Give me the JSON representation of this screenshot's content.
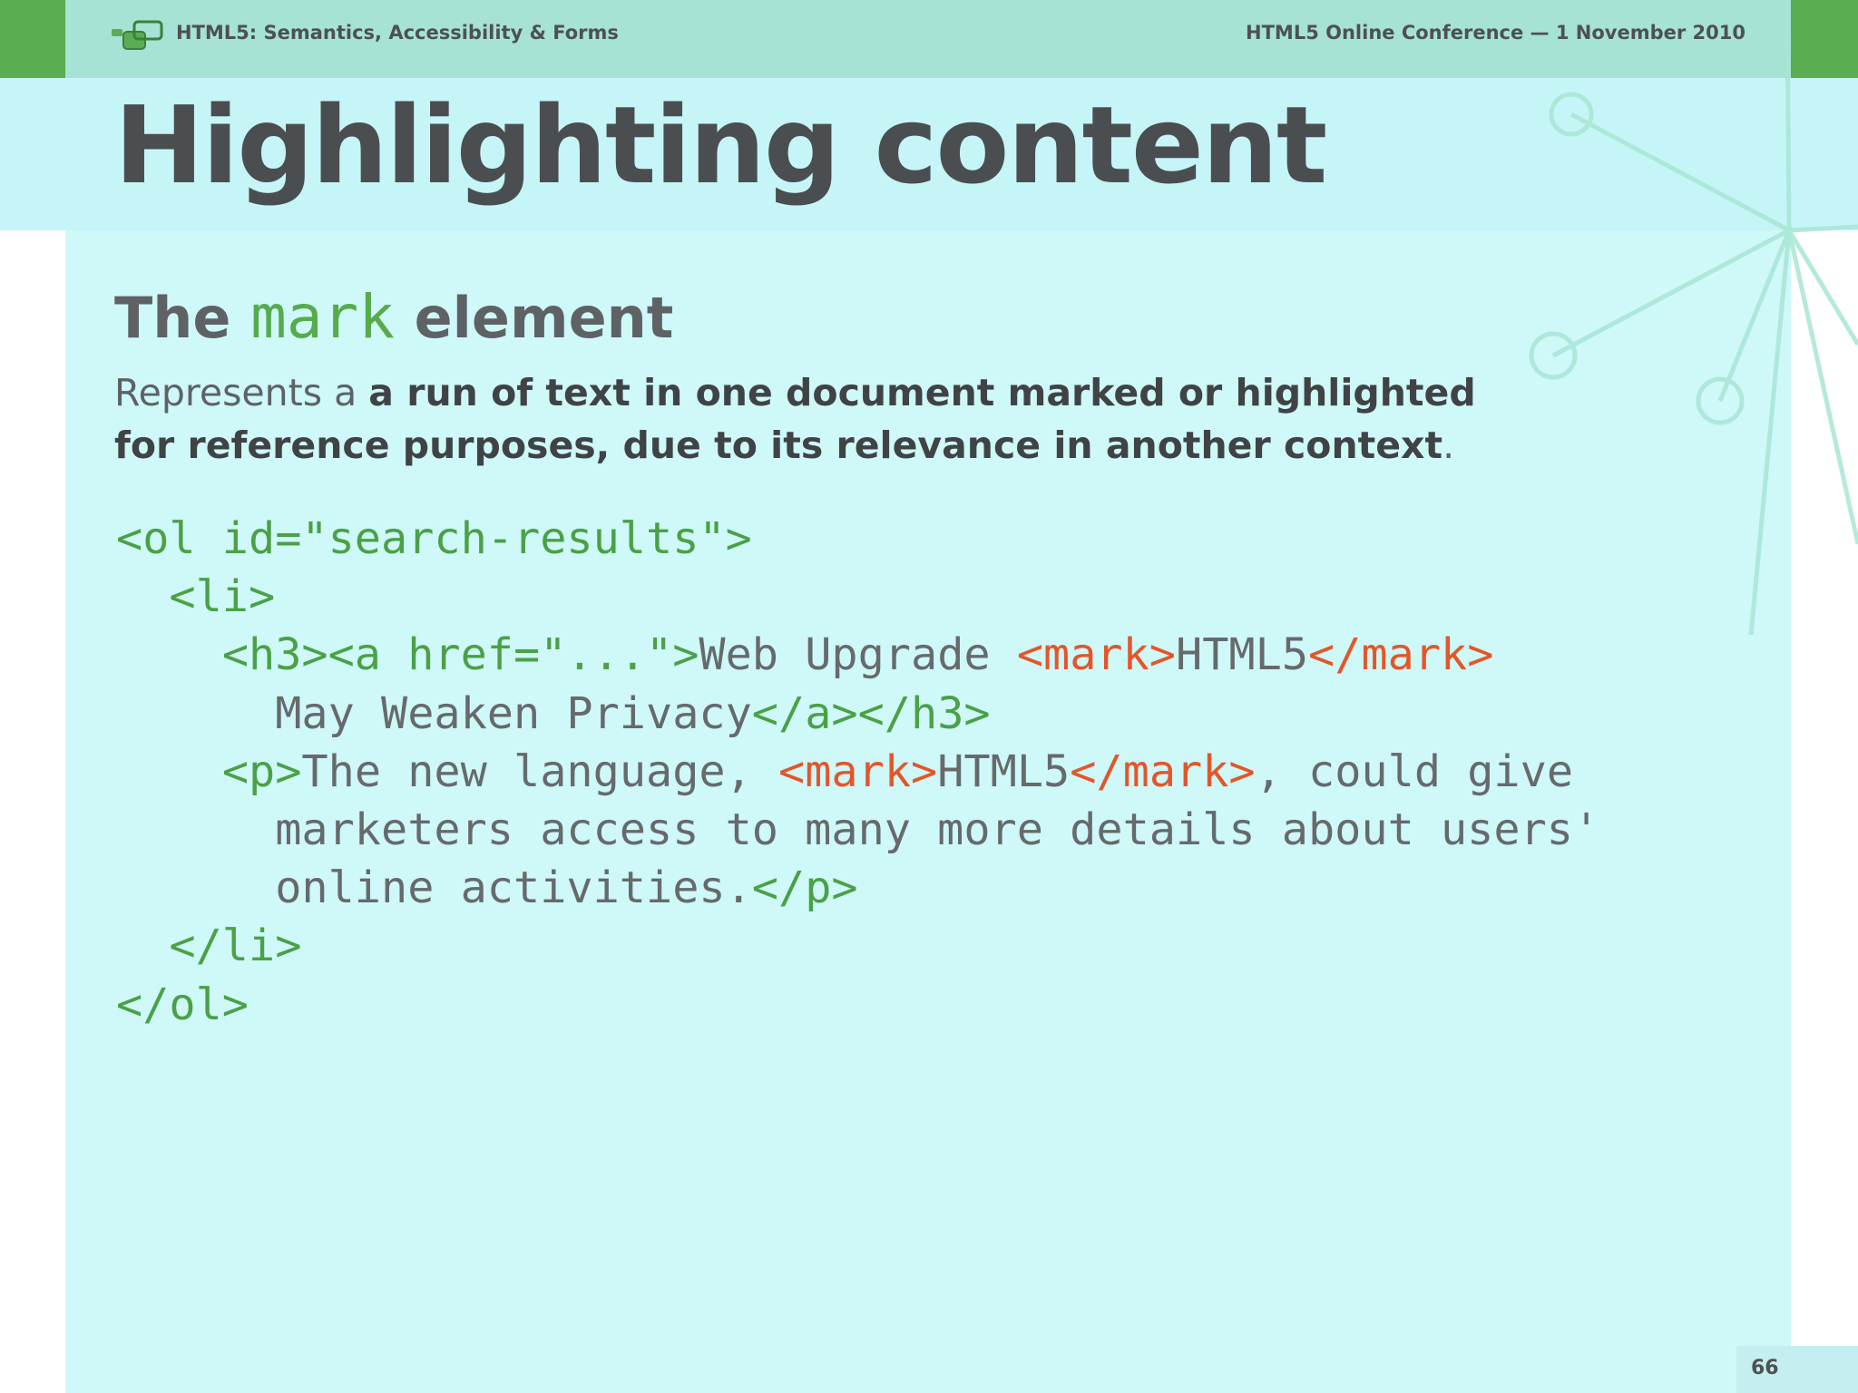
{
  "header": {
    "left_text": "HTML5: Semantics, Accessibility & Forms",
    "right_text": "HTML5 Online Conference — 1 November 2010"
  },
  "slide": {
    "title": "Highlighting content",
    "subtitle_pre": "The ",
    "subtitle_keyword": "mark",
    "subtitle_post": " element",
    "desc_plain": "Represents a ",
    "desc_bold": "a run of text in one document marked or highlighted for reference purposes, due to its relevance in another context",
    "desc_end": "."
  },
  "code": {
    "lines": [
      [
        [
          "t",
          "<ol id=\"search-results\">"
        ]
      ],
      [
        [
          "p",
          "  "
        ],
        [
          "t",
          "<li>"
        ]
      ],
      [
        [
          "p",
          "    "
        ],
        [
          "t",
          "<h3><a href=\"...\">"
        ],
        [
          "p",
          "Web Upgrade "
        ],
        [
          "m",
          "<mark>"
        ],
        [
          "p",
          "HTML5"
        ],
        [
          "m",
          "</mark>"
        ]
      ],
      [
        [
          "p",
          "      May Weaken Privacy"
        ],
        [
          "t",
          "</a></h3>"
        ]
      ],
      [
        [
          "p",
          "    "
        ],
        [
          "t",
          "<p>"
        ],
        [
          "p",
          "The new language, "
        ],
        [
          "m",
          "<mark>"
        ],
        [
          "p",
          "HTML5"
        ],
        [
          "m",
          "</mark>"
        ],
        [
          "p",
          ", could give"
        ]
      ],
      [
        [
          "p",
          "      marketers access to many more details about users'"
        ]
      ],
      [
        [
          "p",
          "      online activities."
        ],
        [
          "t",
          "</p>"
        ]
      ],
      [
        [
          "p",
          "  "
        ],
        [
          "t",
          "</li>"
        ]
      ],
      [
        [
          "t",
          "</ol>"
        ]
      ]
    ]
  },
  "footer": {
    "page_number": "66"
  },
  "colors": {
    "header_band": "#a6e3d4",
    "accent_green": "#5aad52",
    "panel_bg": "#cff8f9",
    "mark_orange": "#e3562a",
    "tag_green": "#4aa146"
  },
  "icons": {
    "logo": "overlapping-windows-logo"
  }
}
